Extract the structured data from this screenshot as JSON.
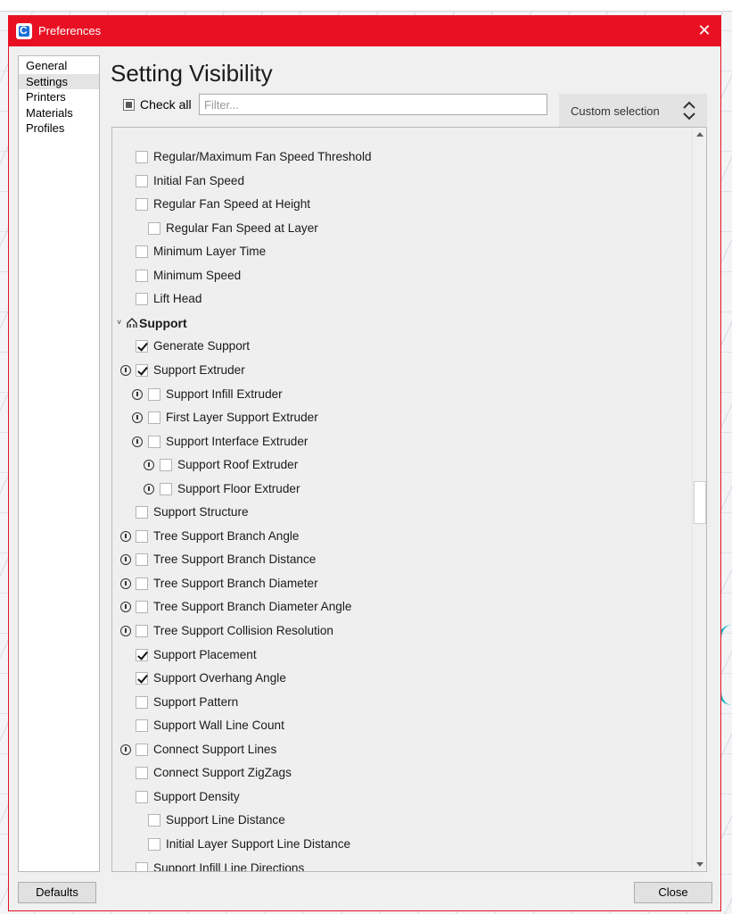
{
  "window": {
    "title": "Preferences"
  },
  "nav": {
    "items": [
      {
        "label": "General",
        "selected": false
      },
      {
        "label": "Settings",
        "selected": true
      },
      {
        "label": "Printers",
        "selected": false
      },
      {
        "label": "Materials",
        "selected": false
      },
      {
        "label": "Profiles",
        "selected": false
      }
    ]
  },
  "panel": {
    "title": "Setting Visibility",
    "check_all_label": "Check all",
    "filter_placeholder": "Filter...",
    "profile_select_value": "Custom selection"
  },
  "settings": [
    {
      "label": "Regular/Maximum Fan Speed Threshold",
      "checked": false,
      "indent": 0,
      "info": false
    },
    {
      "label": "Initial Fan Speed",
      "checked": false,
      "indent": 0,
      "info": false
    },
    {
      "label": "Regular Fan Speed at Height",
      "checked": false,
      "indent": 0,
      "info": false
    },
    {
      "label": "Regular Fan Speed at Layer",
      "checked": false,
      "indent": 1,
      "info": false
    },
    {
      "label": "Minimum Layer Time",
      "checked": false,
      "indent": 0,
      "info": false
    },
    {
      "label": "Minimum Speed",
      "checked": false,
      "indent": 0,
      "info": false
    },
    {
      "label": "Lift Head",
      "checked": false,
      "indent": 0,
      "info": false
    },
    {
      "category": true,
      "label": "Support",
      "icon": "support-icon",
      "expanded": true
    },
    {
      "label": "Generate Support",
      "checked": true,
      "indent": 0,
      "info": false
    },
    {
      "label": "Support Extruder",
      "checked": true,
      "indent": 0,
      "info": true
    },
    {
      "label": "Support Infill Extruder",
      "checked": false,
      "indent": 1,
      "info": true
    },
    {
      "label": "First Layer Support Extruder",
      "checked": false,
      "indent": 1,
      "info": true
    },
    {
      "label": "Support Interface Extruder",
      "checked": false,
      "indent": 1,
      "info": true
    },
    {
      "label": "Support Roof Extruder",
      "checked": false,
      "indent": 2,
      "info": true
    },
    {
      "label": "Support Floor Extruder",
      "checked": false,
      "indent": 2,
      "info": true
    },
    {
      "label": "Support Structure",
      "checked": false,
      "indent": 0,
      "info": false
    },
    {
      "label": "Tree Support Branch Angle",
      "checked": false,
      "indent": 0,
      "info": true
    },
    {
      "label": "Tree Support Branch Distance",
      "checked": false,
      "indent": 0,
      "info": true
    },
    {
      "label": "Tree Support Branch Diameter",
      "checked": false,
      "indent": 0,
      "info": true
    },
    {
      "label": "Tree Support Branch Diameter Angle",
      "checked": false,
      "indent": 0,
      "info": true
    },
    {
      "label": "Tree Support Collision Resolution",
      "checked": false,
      "indent": 0,
      "info": true
    },
    {
      "label": "Support Placement",
      "checked": true,
      "indent": 0,
      "info": false
    },
    {
      "label": "Support Overhang Angle",
      "checked": true,
      "indent": 0,
      "info": false
    },
    {
      "label": "Support Pattern",
      "checked": false,
      "indent": 0,
      "info": false
    },
    {
      "label": "Support Wall Line Count",
      "checked": false,
      "indent": 0,
      "info": false
    },
    {
      "label": "Connect Support Lines",
      "checked": false,
      "indent": 0,
      "info": true
    },
    {
      "label": "Connect Support ZigZags",
      "checked": false,
      "indent": 0,
      "info": false
    },
    {
      "label": "Support Density",
      "checked": false,
      "indent": 0,
      "info": false
    },
    {
      "label": "Support Line Distance",
      "checked": false,
      "indent": 1,
      "info": false
    },
    {
      "label": "Initial Layer Support Line Distance",
      "checked": false,
      "indent": 1,
      "info": false
    },
    {
      "label": "Support Infill Line Directions",
      "checked": false,
      "indent": 0,
      "info": false
    }
  ],
  "buttons": {
    "defaults": "Defaults",
    "close": "Close"
  },
  "colors": {
    "titlebar": "#e81123",
    "accent": "#1a6fd8"
  }
}
